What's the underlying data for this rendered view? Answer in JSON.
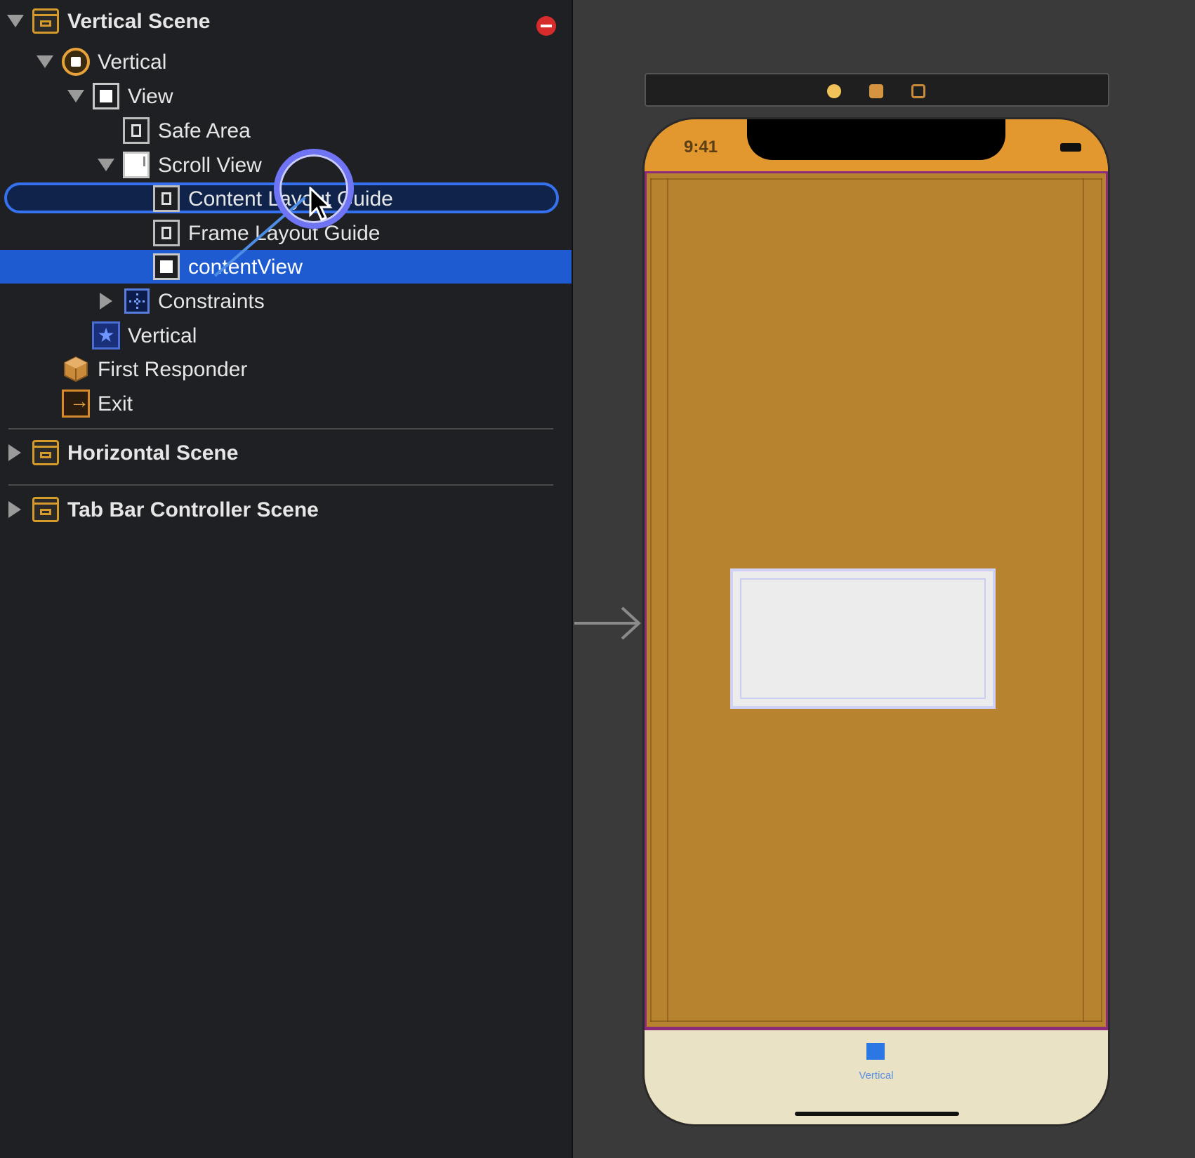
{
  "outline": {
    "scenes": [
      {
        "label": "Vertical Scene"
      },
      {
        "label": "Horizontal Scene"
      },
      {
        "label": "Tab Bar Controller Scene"
      }
    ],
    "items": {
      "vertical_vc": "Vertical",
      "view": "View",
      "safe_area": "Safe Area",
      "scroll_view": "Scroll View",
      "content_layout_guide": "Content Layout Guide",
      "frame_layout_guide": "Frame Layout Guide",
      "content_view": "contentView",
      "constraints": "Constraints",
      "tab_bar_item": "Vertical",
      "first_responder": "First Responder",
      "exit": "Exit"
    }
  },
  "canvas": {
    "status_time": "9:41",
    "tab_label": "Vertical"
  },
  "colors": {
    "selection": "#1f5bd0",
    "phone_background": "#b8832f",
    "status_bar": "#e3982f",
    "tab_bar": "#e9e2c4",
    "accent_blue": "#2b78e4"
  }
}
